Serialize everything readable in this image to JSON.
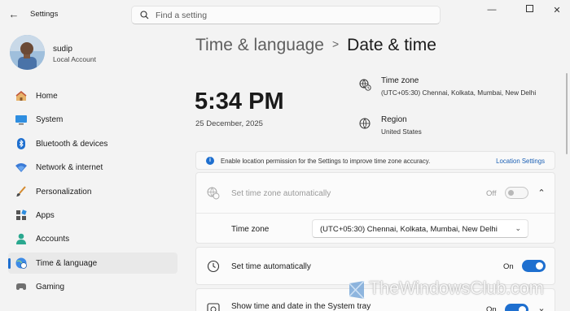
{
  "titlebar": {
    "app_title": "Settings",
    "search_placeholder": "Find a setting"
  },
  "profile": {
    "name": "sudip",
    "account_type": "Local Account"
  },
  "sidebar": {
    "items": [
      {
        "label": "Home",
        "icon": "home-icon"
      },
      {
        "label": "System",
        "icon": "system-icon"
      },
      {
        "label": "Bluetooth & devices",
        "icon": "bluetooth-icon"
      },
      {
        "label": "Network & internet",
        "icon": "wifi-icon"
      },
      {
        "label": "Personalization",
        "icon": "brush-icon"
      },
      {
        "label": "Apps",
        "icon": "apps-icon"
      },
      {
        "label": "Accounts",
        "icon": "person-icon"
      },
      {
        "label": "Time & language",
        "icon": "globe-clock-icon",
        "active": true
      },
      {
        "label": "Gaming",
        "icon": "gamepad-icon"
      }
    ]
  },
  "breadcrumb": {
    "parent": "Time & language",
    "separator": ">",
    "current": "Date & time"
  },
  "clock": {
    "time": "5:34 PM",
    "date": "25 December, 2025"
  },
  "time_zone_info": {
    "title": "Time zone",
    "value": "(UTC+05:30) Chennai, Kolkata, Mumbai, New Delhi"
  },
  "region_info": {
    "title": "Region",
    "value": "United States"
  },
  "banner": {
    "text": "Enable location permission for the Settings to improve time zone accuracy.",
    "link": "Location Settings"
  },
  "settings": {
    "auto_timezone": {
      "label": "Set time zone automatically",
      "state": "Off"
    },
    "time_zone": {
      "label": "Time zone",
      "value": "(UTC+05:30) Chennai, Kolkata, Mumbai, New Delhi"
    },
    "auto_time": {
      "label": "Set time automatically",
      "state": "On"
    },
    "system_tray": {
      "label": "Show time and date in the System tray",
      "state": "On"
    }
  },
  "watermark": {
    "text": "TheWindowsClub.com"
  },
  "colors": {
    "accent": "#1e6fcf",
    "background": "#f3f3f3",
    "card": "#fbfbfb"
  }
}
